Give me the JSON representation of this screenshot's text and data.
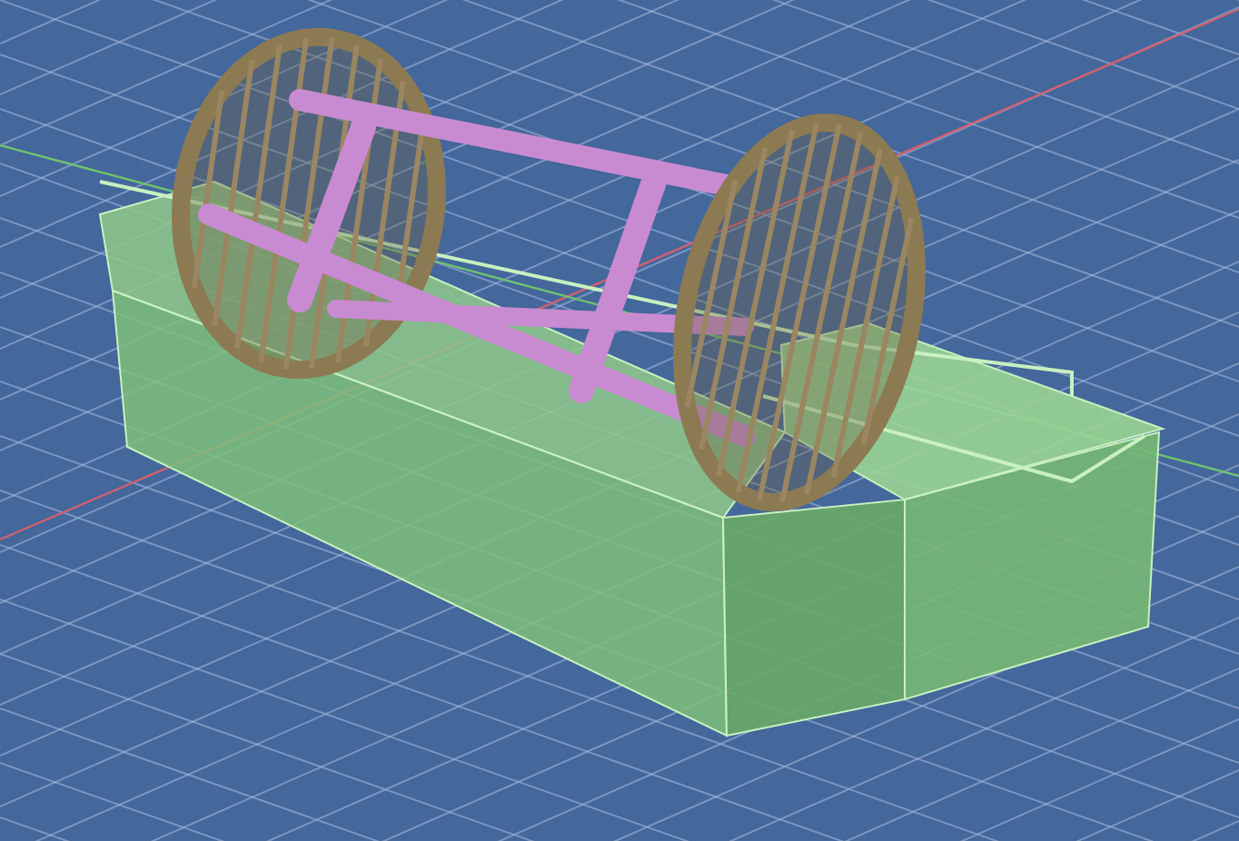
{
  "viewport": {
    "kind": "render"
  }
}
